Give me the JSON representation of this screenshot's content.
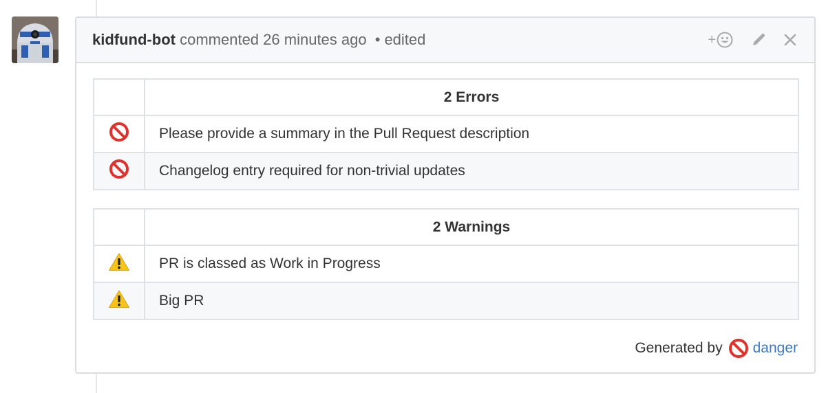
{
  "comment": {
    "author": "kidfund-bot",
    "action": "commented",
    "time": "26 minutes ago",
    "separator": "•",
    "edited": "edited",
    "add_reaction": "+"
  },
  "errors_table": {
    "header": "2 Errors",
    "rows": [
      {
        "icon": "no-entry-icon",
        "message": "Please provide a summary in the Pull Request description"
      },
      {
        "icon": "no-entry-icon",
        "message": "Changelog entry required for non-trivial updates"
      }
    ]
  },
  "warnings_table": {
    "header": "2 Warnings",
    "rows": [
      {
        "icon": "warning-icon",
        "message": "PR is classed as Work in Progress"
      },
      {
        "icon": "warning-icon",
        "message": "Big PR"
      }
    ]
  },
  "footer": {
    "generated_by": "Generated by",
    "link_text": "danger"
  },
  "colors": {
    "link": "#4078c0",
    "no_entry": "#e0312c",
    "warning": "#f7c51a",
    "header_bg": "#f6f8fa",
    "border": "#dfe2e5"
  }
}
